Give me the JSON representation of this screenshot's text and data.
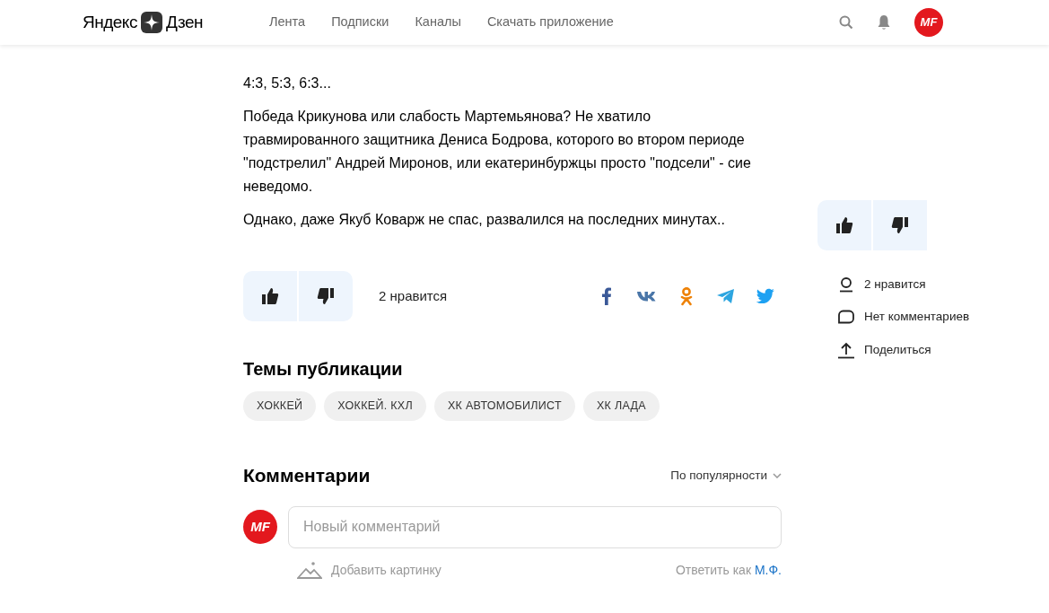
{
  "header": {
    "logo": {
      "left": "Яндекс",
      "right": "Дзен"
    },
    "nav": [
      {
        "label": "Лента"
      },
      {
        "label": "Подписки"
      },
      {
        "label": "Каналы"
      },
      {
        "label": "Скачать приложение"
      }
    ],
    "avatar": "MF"
  },
  "article": {
    "paragraphs": [
      "4:3, 5:3, 6:3...",
      "Победа Крикунова или слабость Мартемьянова? Не хватило травмированного защитника Дениса Бодрова, которого во втором периоде \"подстрелил\" Андрей Миронов, или екатеринбуржцы просто \"подсели\" - сие неведомо.",
      "Однако, даже Якуб Коварж не спас, развалился на последних минутах.."
    ],
    "likes": "2 нравится",
    "share": [
      {
        "kind": "facebook",
        "color": "#3b5998"
      },
      {
        "kind": "vk",
        "color": "#4a76a8"
      },
      {
        "kind": "ok",
        "color": "#ee8208"
      },
      {
        "kind": "telegram",
        "color": "#2ca5e0"
      },
      {
        "kind": "twitter",
        "color": "#1da1f2"
      }
    ]
  },
  "topics": {
    "title": "Темы публикации",
    "tags": [
      "ХОККЕЙ",
      "ХОККЕЙ. КХЛ",
      "ХК АВТОМОБИЛИСТ",
      "ХК ЛАДА"
    ]
  },
  "comments": {
    "title": "Комментарии",
    "sort": "По популярности",
    "avatar": "MF",
    "placeholder": "Новый комментарий",
    "add_image": "Добавить картинку",
    "reply_as": "Ответить как",
    "user": "М.Ф."
  },
  "sidebar": {
    "stats": [
      {
        "kind": "likes",
        "label": "2 нравится"
      },
      {
        "kind": "comments",
        "label": "Нет комментариев"
      },
      {
        "kind": "share",
        "label": "Поделиться"
      }
    ]
  }
}
